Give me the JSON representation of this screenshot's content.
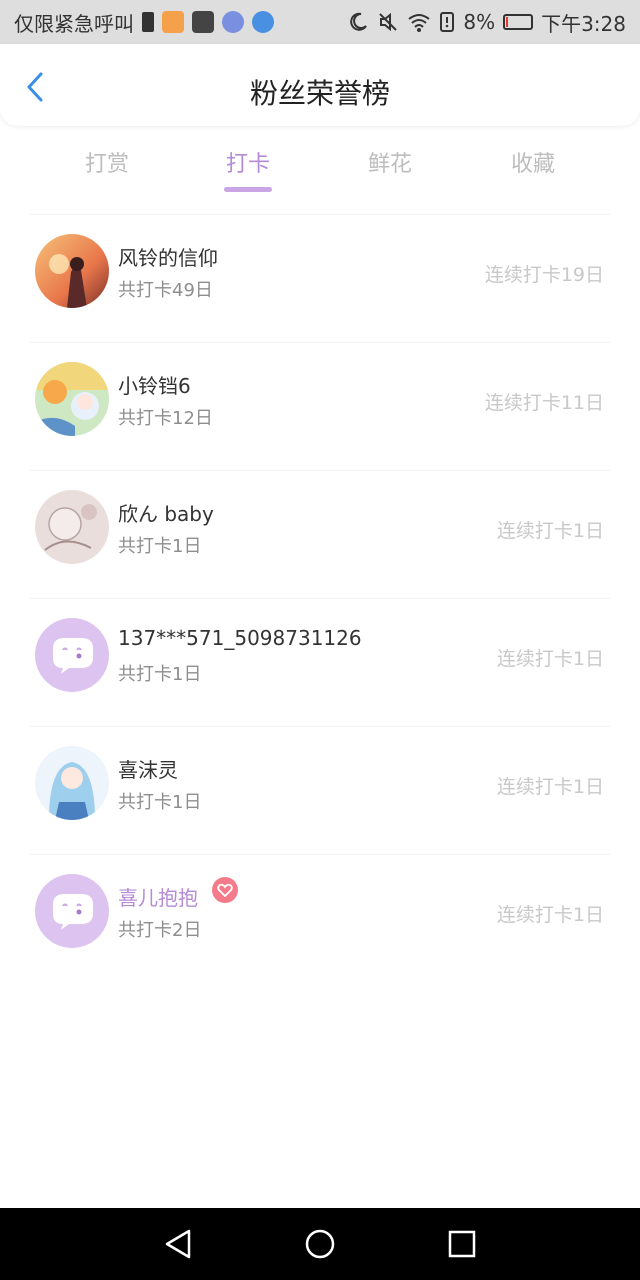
{
  "status_bar": {
    "carrier_text": "仅限紧急呼叫",
    "battery_percent": "8%",
    "time": "下午3:28"
  },
  "header": {
    "title": "粉丝荣誉榜"
  },
  "tabs": [
    {
      "label": "打赏"
    },
    {
      "label": "打卡"
    },
    {
      "label": "鲜花"
    },
    {
      "label": "收藏"
    }
  ],
  "active_tab": 1,
  "list": [
    {
      "name": "风铃的信仰",
      "total": "共打卡49日",
      "streak": "连续打卡19日",
      "avatar": "photo-sunset-girl"
    },
    {
      "name": "小铃铛6",
      "total": "共打卡12日",
      "streak": "连续打卡11日",
      "avatar": "photo-anime-duo"
    },
    {
      "name": "欣ん baby",
      "total": "共打卡1日",
      "streak": "连续打卡1日",
      "avatar": "photo-sketch"
    },
    {
      "name": "137***571_5098731126",
      "total": "共打卡1日",
      "streak": "连续打卡1日",
      "avatar": "default-chat-avatar"
    },
    {
      "name": "喜沫灵",
      "total": "共打卡1日",
      "streak": "连续打卡1日",
      "avatar": "photo-anime-blue-hair"
    },
    {
      "name": "喜儿抱抱",
      "total": "共打卡2日",
      "streak": "连续打卡1日",
      "avatar": "default-chat-avatar",
      "vip": true
    }
  ],
  "colors": {
    "accent": "#b68bd6",
    "tab_underline": "#c9a5e4",
    "back_arrow": "#3a8ee6",
    "vip_badge": "#f67b8a"
  }
}
